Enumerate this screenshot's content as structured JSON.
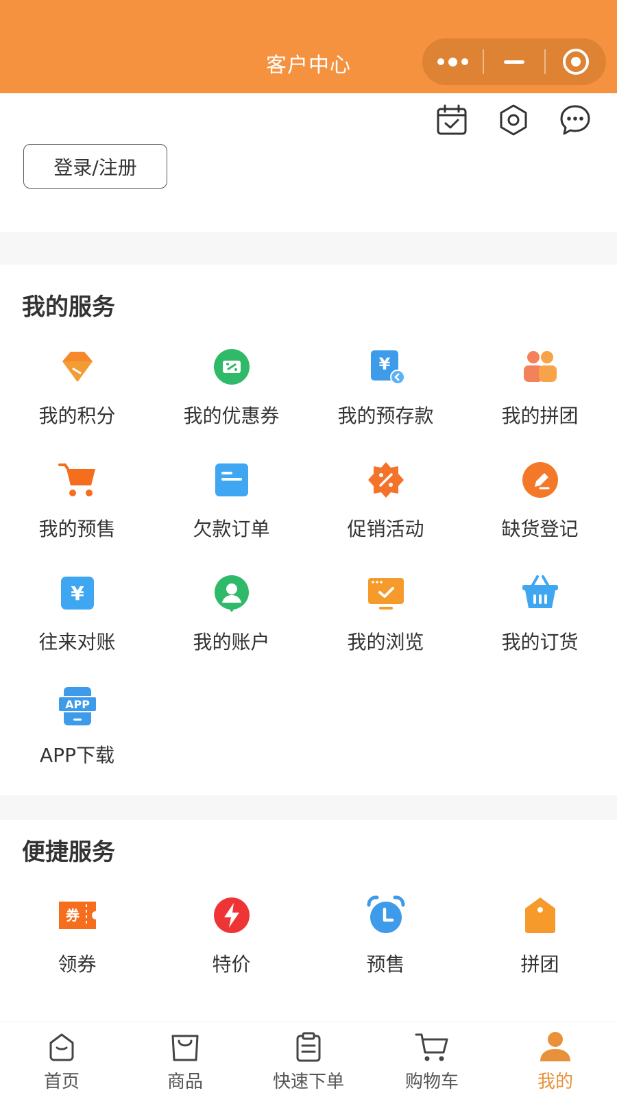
{
  "header": {
    "title": "客户中心"
  },
  "top_tools": [
    {
      "name": "calendar-check-icon"
    },
    {
      "name": "settings-hexagon-icon"
    },
    {
      "name": "message-chat-icon"
    }
  ],
  "login": {
    "label": "登录/注册"
  },
  "my_services": {
    "title": "我的服务",
    "items": [
      {
        "label": "我的积分",
        "icon": "diamond-points-icon",
        "color": "#F5892B"
      },
      {
        "label": "我的优惠券",
        "icon": "coupon-icon",
        "color": "#2FBA6A"
      },
      {
        "label": "我的预存款",
        "icon": "prepaid-yen-icon",
        "color": "#3E9BEA"
      },
      {
        "label": "我的拼团",
        "icon": "group-users-icon",
        "color": "#F3825A"
      },
      {
        "label": "我的预售",
        "icon": "cart-presale-icon",
        "color": "#F56E1E"
      },
      {
        "label": "欠款订单",
        "icon": "debt-order-icon",
        "color": "#3FA6F2"
      },
      {
        "label": "促销活动",
        "icon": "promotion-badge-icon",
        "color": "#F4722A"
      },
      {
        "label": "缺货登记",
        "icon": "stockout-edit-icon",
        "color": "#F4782A"
      },
      {
        "label": "往来对账",
        "icon": "reconcile-yen-icon",
        "color": "#3FA6F2"
      },
      {
        "label": "我的账户",
        "icon": "account-user-icon",
        "color": "#2FBA6A"
      },
      {
        "label": "我的浏览",
        "icon": "browse-monitor-icon",
        "color": "#F59A2B"
      },
      {
        "label": "我的订货",
        "icon": "order-basket-icon",
        "color": "#3FA6F2"
      },
      {
        "label": "APP下载",
        "icon": "app-download-icon",
        "color": "#3E9BEA",
        "badge": "APP"
      }
    ]
  },
  "quick_services": {
    "title": "便捷服务",
    "items": [
      {
        "label": "领券",
        "icon": "ticket-coupon-icon",
        "color": "#F56E1E",
        "badge": "券"
      },
      {
        "label": "特价",
        "icon": "lightning-sale-icon",
        "color": "#EE3434"
      },
      {
        "label": "预售",
        "icon": "alarm-clock-icon",
        "color": "#3E9BEA"
      },
      {
        "label": "拼团",
        "icon": "tag-group-icon",
        "color": "#F59A2B"
      }
    ]
  },
  "tabbar": {
    "active": 4,
    "accent": "#E9913A",
    "items": [
      {
        "label": "首页",
        "icon": "home-icon"
      },
      {
        "label": "商品",
        "icon": "shopping-bag-icon"
      },
      {
        "label": "快速下单",
        "icon": "clipboard-order-icon"
      },
      {
        "label": "购物车",
        "icon": "shopping-cart-icon"
      },
      {
        "label": "我的",
        "icon": "profile-user-icon"
      }
    ]
  }
}
